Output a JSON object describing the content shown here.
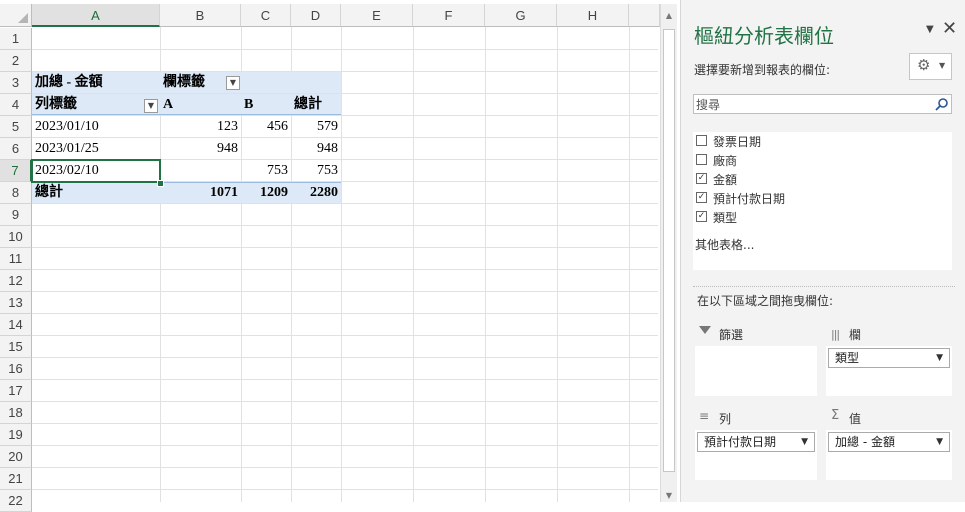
{
  "sheet": {
    "columns": [
      "A",
      "B",
      "C",
      "D",
      "E",
      "F",
      "G",
      "H"
    ],
    "rows": [
      "1",
      "2",
      "3",
      "4",
      "5",
      "6",
      "7",
      "8",
      "9",
      "10",
      "11",
      "12",
      "13",
      "14",
      "15",
      "16",
      "17",
      "18",
      "19",
      "20",
      "21",
      "22"
    ],
    "pivot": {
      "r3": {
        "a": "加總 - 金額",
        "b": "欄標籤"
      },
      "r4": {
        "a": "列標籤",
        "b": "A",
        "c": "B",
        "d": "總計"
      },
      "r5": {
        "a": "2023/01/10",
        "b": "123",
        "c": "456",
        "d": "579"
      },
      "r6": {
        "a": "2023/01/25",
        "b": "948",
        "c": "",
        "d": "948"
      },
      "r7": {
        "a": "2023/02/10",
        "b": "",
        "c": "753",
        "d": "753"
      },
      "r8": {
        "a": "總計",
        "b": "1071",
        "c": "1209",
        "d": "2280"
      }
    }
  },
  "pane": {
    "title": "樞紐分析表欄位",
    "choose_label": "選擇要新增到報表的欄位:",
    "search_placeholder": "搜尋",
    "fields": [
      {
        "label": "發票日期",
        "checked": false
      },
      {
        "label": "廠商",
        "checked": false
      },
      {
        "label": "金額",
        "checked": true
      },
      {
        "label": "預計付款日期",
        "checked": true
      },
      {
        "label": "類型",
        "checked": true
      }
    ],
    "more_tables": "其他表格...",
    "drag_label": "在以下區域之間拖曳欄位:",
    "areas": {
      "filter": {
        "title": "篩選"
      },
      "columns": {
        "title": "欄",
        "pill": "類型"
      },
      "rows": {
        "title": "列",
        "pill": "預計付款日期"
      },
      "values": {
        "title": "值",
        "pill": "加總 - 金額"
      }
    },
    "icons": {
      "close": "close-icon",
      "menu": "chevron-down-icon",
      "gear": "gear-icon",
      "search": "search-icon"
    }
  },
  "colors": {
    "accent": "#217346",
    "pivot_fill": "#dde9f6"
  }
}
